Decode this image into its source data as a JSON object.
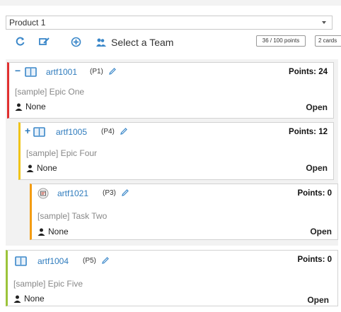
{
  "product": {
    "selected": "Product 1"
  },
  "toolbar": {
    "team_label": "Select a Team",
    "points_summary": "36 / 100 points",
    "cards_summary": "2 cards"
  },
  "cards": [
    {
      "toggle": "−",
      "id": "artf1001",
      "priority": "(P1)",
      "points": "Points: 24",
      "title": "[sample] Epic One",
      "owner": "None",
      "status": "Open",
      "accent": "#e02f2f"
    },
    {
      "toggle": "+",
      "id": "artf1005",
      "priority": "(P4)",
      "points": "Points: 12",
      "title": "[sample] Epic Four",
      "owner": "None",
      "status": "Open",
      "accent": "#f0c419"
    },
    {
      "toggle": "",
      "id": "artf1021",
      "priority": "(P3)",
      "points": "Points: 0",
      "title": "[sample] Task Two",
      "owner": "None",
      "status": "Open",
      "accent": "#f39c12"
    },
    {
      "toggle": "",
      "id": "artf1004",
      "priority": "(P5)",
      "points": "Points: 0",
      "title": "[sample] Epic Five",
      "owner": "None",
      "status": "Open",
      "accent": "#9cc43a"
    }
  ],
  "colors": {
    "link": "#2e7bbd",
    "icon": "#3a87c9"
  }
}
